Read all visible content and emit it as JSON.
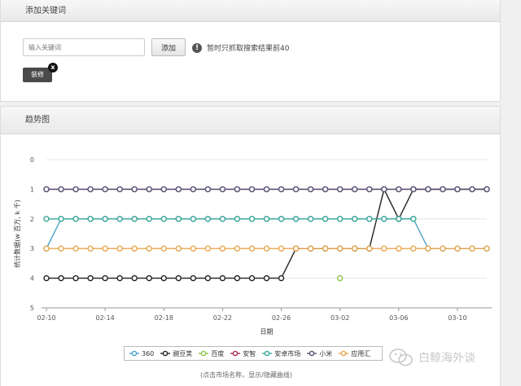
{
  "keyword_panel": {
    "title": "添加关键词",
    "input_placeholder": "输入关键词",
    "add_button": "添加",
    "info_text": "暂时只抓取搜索结果前40",
    "tag_label": "装修",
    "tag_close": "x"
  },
  "trend_panel": {
    "title": "趋势图",
    "hint": "(点击市场名称，显示/隐藏曲线)"
  },
  "watermark": "白鲸海外谈",
  "chart_data": {
    "type": "line",
    "title": "",
    "xlabel": "日期",
    "ylabel": "统计数据(w 百万, k 千)",
    "ylim": [
      0,
      5
    ],
    "y_inverted": true,
    "yticks": [
      "0",
      "1",
      "2",
      "3",
      "4",
      "5"
    ],
    "x_start": "02-10",
    "x_end": "03-12",
    "xtick_labels": [
      "02-10",
      "02-14",
      "02-18",
      "02-22",
      "02-26",
      "03-02",
      "03-06",
      "03-10"
    ],
    "xtick_offsets": [
      0,
      4,
      8,
      12,
      16,
      20,
      24,
      28
    ],
    "grid": true,
    "legend_position": "bottom-center",
    "series": [
      {
        "name": "360",
        "color": "#4aa3c7",
        "values": [
          3,
          2,
          2,
          2,
          2,
          2,
          2,
          2,
          2,
          2,
          2,
          2,
          2,
          2,
          2,
          2,
          2,
          2,
          2,
          2,
          2,
          2,
          2,
          2,
          2,
          2,
          3,
          3,
          3,
          3,
          3
        ]
      },
      {
        "name": "豌豆荚",
        "color": "#222222",
        "values": [
          4,
          4,
          4,
          4,
          4,
          4,
          4,
          4,
          4,
          4,
          4,
          4,
          4,
          4,
          4,
          4,
          4,
          3,
          3,
          3,
          3,
          3,
          3,
          1,
          2,
          1,
          1,
          1,
          1,
          1,
          1
        ]
      },
      {
        "name": "百度",
        "color": "#8ac24a",
        "values": [
          null,
          null,
          null,
          null,
          null,
          null,
          2,
          null,
          null,
          null,
          null,
          null,
          null,
          2,
          null,
          null,
          null,
          null,
          null,
          null,
          4,
          null,
          null,
          null,
          null,
          null,
          null,
          null,
          null,
          null,
          null
        ]
      },
      {
        "name": "安智",
        "color": "#a52a58",
        "values": [
          1,
          1,
          1,
          1,
          1,
          1,
          1,
          1,
          1,
          1,
          1,
          1,
          1,
          1,
          1,
          1,
          1,
          1,
          1,
          1,
          1,
          1,
          1,
          1,
          1,
          1,
          1,
          1,
          1,
          1,
          1
        ]
      },
      {
        "name": "安卓市场",
        "color": "#3aa79a",
        "values": [
          2,
          2,
          2,
          2,
          2,
          2,
          2,
          2,
          2,
          2,
          2,
          2,
          2,
          2,
          2,
          2,
          2,
          2,
          2,
          2,
          2,
          2,
          2,
          2,
          2,
          2,
          null,
          null,
          null,
          null,
          null
        ]
      },
      {
        "name": "小米",
        "color": "#555577",
        "values": [
          1,
          1,
          1,
          1,
          1,
          1,
          1,
          1,
          1,
          1,
          1,
          1,
          1,
          1,
          1,
          1,
          1,
          1,
          1,
          1,
          1,
          1,
          1,
          1,
          1,
          1,
          1,
          1,
          1,
          1,
          1
        ]
      },
      {
        "name": "应用汇",
        "color": "#e8a64e",
        "values": [
          3,
          3,
          3,
          3,
          3,
          3,
          3,
          3,
          3,
          3,
          3,
          3,
          3,
          3,
          3,
          3,
          3,
          3,
          3,
          3,
          3,
          3,
          3,
          3,
          3,
          3,
          3,
          3,
          3,
          3,
          3
        ]
      }
    ]
  }
}
